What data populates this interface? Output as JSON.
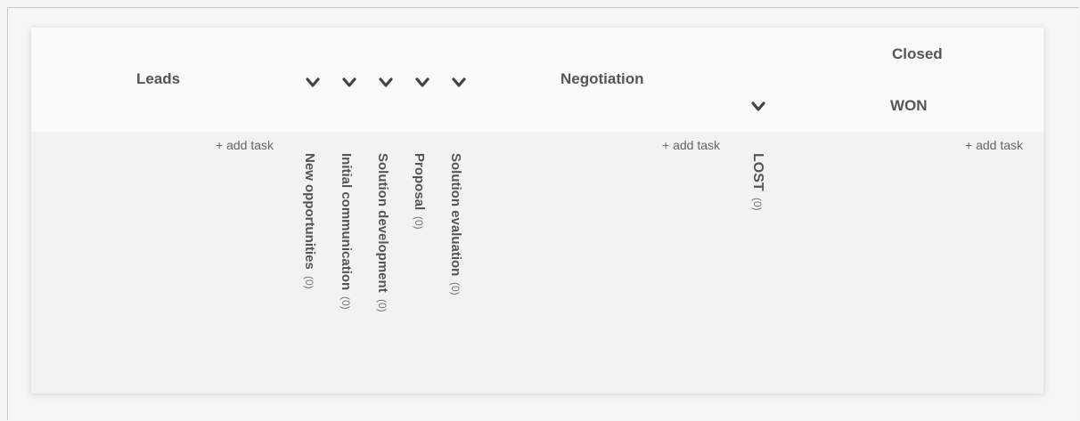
{
  "columns": {
    "leads": {
      "title": "Leads",
      "add_task": "+ add task"
    },
    "negotiation": {
      "title": "Negotiation",
      "add_task": "+ add task"
    },
    "closed": {
      "title": "Closed",
      "sub_title": "WON",
      "add_task": "+ add task"
    }
  },
  "collapsed_columns": [
    {
      "label": "New opportunities",
      "count": "(0)"
    },
    {
      "label": "Initial communication",
      "count": "(0)"
    },
    {
      "label": "Solution development",
      "count": "(0)"
    },
    {
      "label": "Proposal",
      "count": "(0)"
    },
    {
      "label": "Solution evaluation",
      "count": "(0)"
    }
  ],
  "lost_column": {
    "label": "LOST",
    "count": "(0)"
  },
  "icons": {
    "expand": "chevron-down-icon"
  },
  "colors": {
    "background": "#f4f4f4",
    "header_bg": "#fafafa",
    "body_bg": "#f2f2f2",
    "text": "#555555"
  }
}
